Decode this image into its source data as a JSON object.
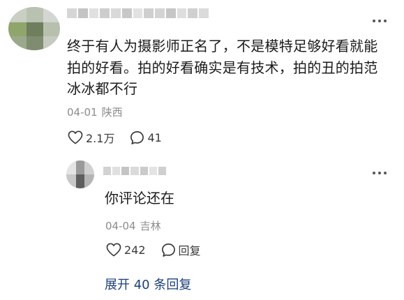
{
  "comment": {
    "text": "终于有人为摄影师正名了，不是模特足够好看就能拍的好看。拍的好看确实是有技术，拍的丑的拍范冰冰都不行",
    "date": "04-01",
    "location": "陕西",
    "like_count": "2.1万",
    "reply_count": "41"
  },
  "reply": {
    "text": "你评论还在",
    "date": "04-04",
    "location": "吉林",
    "like_count": "242",
    "reply_label": "回复"
  },
  "expand": {
    "label": "展开 40 条回复"
  },
  "icons": {
    "like": "heart-outline-icon",
    "comment": "speech-bubble-icon",
    "more": "more-dots-icon"
  },
  "colors": {
    "text": "#1b1b1b",
    "meta": "#8c8c8c",
    "link": "#1d3f7a"
  }
}
